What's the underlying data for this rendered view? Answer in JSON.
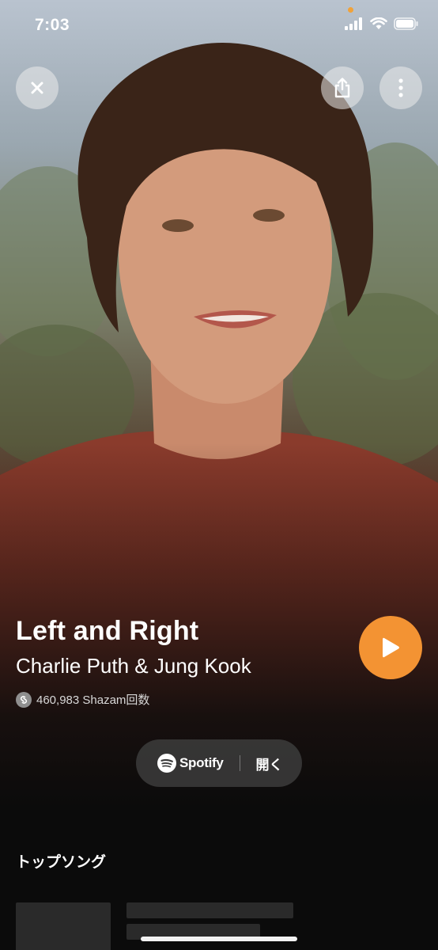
{
  "status_bar": {
    "time": "7:03",
    "icons": [
      "signal-icon",
      "wifi-icon",
      "battery-icon"
    ],
    "recording_dot_color": "#f0a23a"
  },
  "top_bar": {
    "close_icon": "close-icon",
    "share_icon": "share-icon",
    "more_icon": "more-vertical-icon"
  },
  "song": {
    "title": "Left and Right",
    "artist": "Charlie Puth & Jung Kook",
    "shazam_count": "460,983 Shazam回数"
  },
  "play_button": {
    "icon": "play-icon",
    "color": "#f39333"
  },
  "spotify": {
    "name": "Spotify",
    "open_label": "開く"
  },
  "top_songs": {
    "title": "トップソング"
  }
}
